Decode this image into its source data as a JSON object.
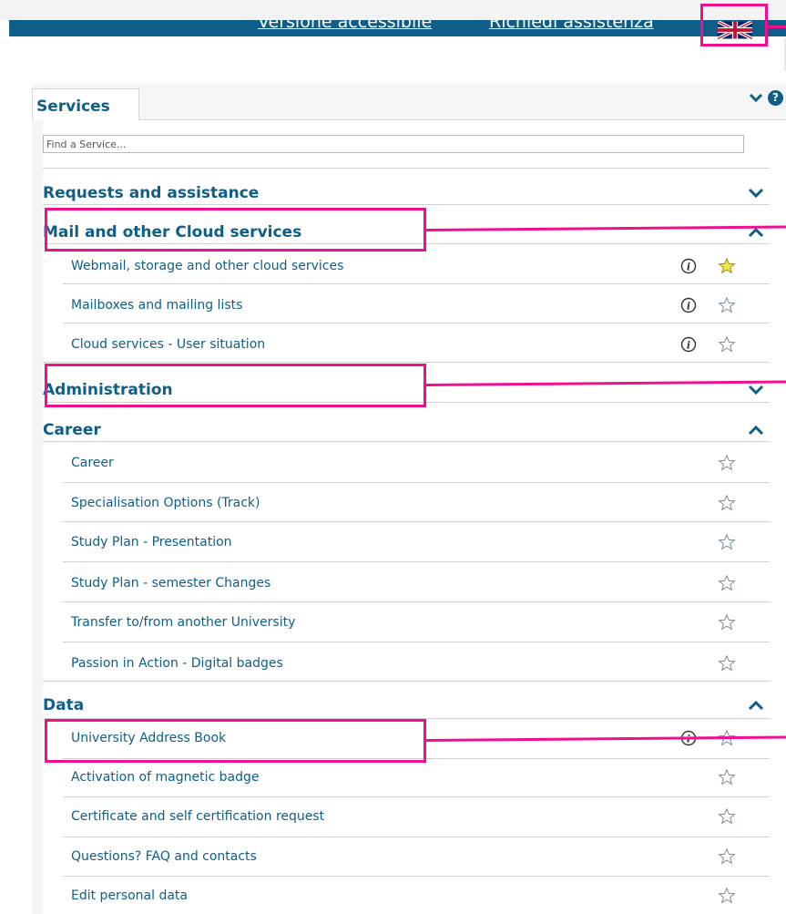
{
  "header": {
    "links": [
      "Versione accessibile",
      "Richiedi assistenza"
    ],
    "language_flag": "uk-flag-icon"
  },
  "panel": {
    "tab_label": "Services",
    "search_placeholder": "Find a Service..."
  },
  "sections": [
    {
      "title": "Requests and assistance",
      "expanded": false,
      "items": []
    },
    {
      "title": "Mail and other Cloud services",
      "expanded": true,
      "items": [
        {
          "label": "Webmail, storage and other cloud services",
          "info": true,
          "favorite": true
        },
        {
          "label": "Mailboxes and mailing lists",
          "info": true,
          "favorite": false
        },
        {
          "label": "Cloud services - User situation",
          "info": true,
          "favorite": false
        }
      ]
    },
    {
      "title": "Administration",
      "expanded": false,
      "items": []
    },
    {
      "title": "Career",
      "expanded": true,
      "items": [
        {
          "label": "Career",
          "info": false,
          "favorite": false
        },
        {
          "label": "Specialisation Options (Track)",
          "info": false,
          "favorite": false
        },
        {
          "label": "Study Plan - Presentation",
          "info": false,
          "favorite": false
        },
        {
          "label": "Study Plan - semester Changes",
          "info": false,
          "favorite": false
        },
        {
          "label": "Transfer to/from another University",
          "info": false,
          "favorite": false
        },
        {
          "label": "Passion in Action - Digital badges",
          "info": false,
          "favorite": false
        }
      ]
    },
    {
      "title": "Data",
      "expanded": true,
      "items": [
        {
          "label": "University Address Book",
          "info": true,
          "favorite": false
        },
        {
          "label": "Activation of magnetic badge",
          "info": false,
          "favorite": false
        },
        {
          "label": "Certificate and self certification request",
          "info": false,
          "favorite": false
        },
        {
          "label": "Questions? FAQ and contacts",
          "info": false,
          "favorite": false
        },
        {
          "label": "Edit personal data",
          "info": false,
          "favorite": false
        }
      ]
    }
  ],
  "colors": {
    "brand": "#0e5e89",
    "highlight": "#f0108f",
    "favorite_star": "#f1e64a"
  }
}
